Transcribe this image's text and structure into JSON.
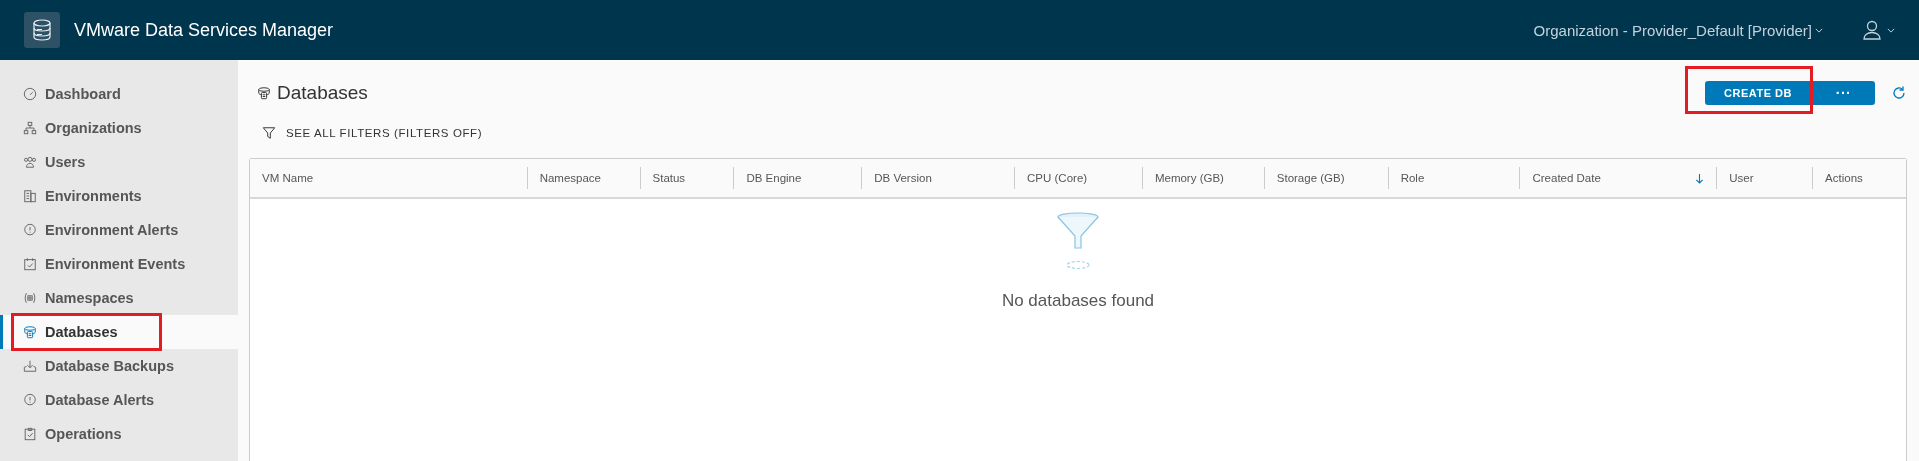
{
  "header": {
    "title": "VMware Data Services Manager",
    "organization": "Organization - Provider_Default [Provider]"
  },
  "sidebar": {
    "items": [
      {
        "label": "Dashboard",
        "selected": false,
        "highlighted": false
      },
      {
        "label": "Organizations",
        "selected": false,
        "highlighted": false
      },
      {
        "label": "Users",
        "selected": false,
        "highlighted": false
      },
      {
        "label": "Environments",
        "selected": false,
        "highlighted": false
      },
      {
        "label": "Environment Alerts",
        "selected": false,
        "highlighted": false
      },
      {
        "label": "Environment Events",
        "selected": false,
        "highlighted": false
      },
      {
        "label": "Namespaces",
        "selected": false,
        "highlighted": false
      },
      {
        "label": "Databases",
        "selected": true,
        "highlighted": true
      },
      {
        "label": "Database Backups",
        "selected": false,
        "highlighted": false
      },
      {
        "label": "Database Alerts",
        "selected": false,
        "highlighted": false
      },
      {
        "label": "Operations",
        "selected": false,
        "highlighted": false
      }
    ]
  },
  "page": {
    "title": "Databases",
    "filter_link": "SEE ALL FILTERS (FILTERS OFF)",
    "create_button": {
      "label": "CREATE DB",
      "highlighted": true
    },
    "more_button": "···"
  },
  "table": {
    "columns": [
      {
        "label": "VM Name",
        "sorted": false
      },
      {
        "label": "Namespace",
        "sorted": false
      },
      {
        "label": "Status",
        "sorted": false
      },
      {
        "label": "DB Engine",
        "sorted": false
      },
      {
        "label": "DB Version",
        "sorted": false
      },
      {
        "label": "CPU (Core)",
        "sorted": false
      },
      {
        "label": "Memory (GB)",
        "sorted": false
      },
      {
        "label": "Storage (GB)",
        "sorted": false
      },
      {
        "label": "Role",
        "sorted": false
      },
      {
        "label": "Created Date",
        "sorted": true
      },
      {
        "label": "User",
        "sorted": false
      },
      {
        "label": "Actions",
        "sorted": false
      }
    ],
    "empty_message": "No databases found"
  }
}
